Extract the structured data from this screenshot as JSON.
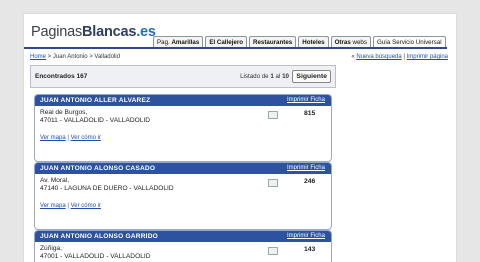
{
  "logo": {
    "pre": "Paginas",
    "main": "Blancas",
    "tld": ".es"
  },
  "tabs": [
    {
      "prefix": "Pag. ",
      "label": "Amarillas",
      "selected": false
    },
    {
      "prefix": "",
      "label": "El Callejero",
      "selected": false
    },
    {
      "prefix": "",
      "label": "Restaurantes",
      "selected": false
    },
    {
      "prefix": "",
      "label": "Hoteles",
      "selected": false
    },
    {
      "prefix": "",
      "label": "Otras",
      "suffix": " webs",
      "selected": false
    },
    {
      "prefix": "",
      "label": "Guía Servicio Universal",
      "selected": true
    }
  ],
  "breadcrumb": {
    "home": "Home",
    "sep": " > ",
    "item1": "Juan Antonio",
    "item2": "Valladolid"
  },
  "top_links": {
    "prefix": "« ",
    "new_search": "Nueva búsqueda",
    "sep": " | ",
    "print_page": "Imprimir página"
  },
  "results": {
    "found_label": "Encontrados",
    "found_count": "167",
    "listing_text": "Listado de",
    "current_page": "1",
    "of": "al",
    "total_pages": "10",
    "next": "Siguiente"
  },
  "cards": [
    {
      "name": "JUAN ANTONIO ALLER ALVAREZ",
      "print": "Imprimir Ficha",
      "street": "Real de Burgos,",
      "postal": "47011",
      "city": "- VALLADOLID - VALLADOLID",
      "phone": "815",
      "map": "Ver mapa",
      "sep": "|",
      "howto": "Ver cómo ir"
    },
    {
      "name": "JUAN ANTONIO ALONSO CASADO",
      "print": "Imprimir Ficha",
      "street": "Av. Moral,",
      "postal": "47140",
      "city": "- LAGUNA DE DUERO - VALLADOLID",
      "phone": "246",
      "map": "Ver mapa",
      "sep": "|",
      "howto": "Ver cómo ir"
    },
    {
      "name": "JUAN ANTONIO ALONSO GARRIDO",
      "print": "Imprimir Ficha",
      "street": "Zúñiga,",
      "postal": "47001",
      "city": "- VALLADOLID - VALLADOLID",
      "phone": "143"
    }
  ]
}
